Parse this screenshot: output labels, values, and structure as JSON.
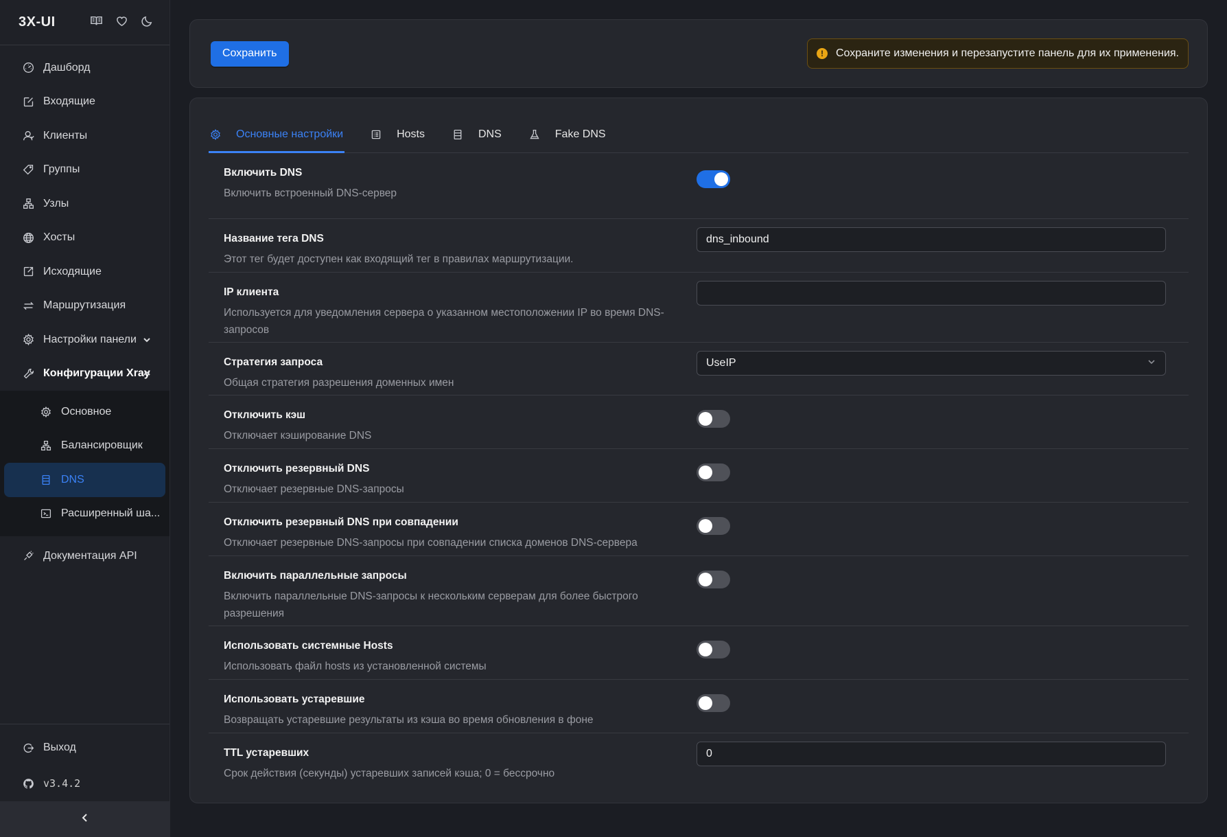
{
  "sidebar": {
    "brand": "3X-UI",
    "brand_icons": [
      "book-icon",
      "heart-icon",
      "moon-icon"
    ],
    "items": [
      {
        "label": "Дашборд",
        "icon": "dashboard-icon"
      },
      {
        "label": "Входящие",
        "icon": "inbound-icon"
      },
      {
        "label": "Клиенты",
        "icon": "clients-icon"
      },
      {
        "label": "Группы",
        "icon": "tag-icon"
      },
      {
        "label": "Узлы",
        "icon": "nodes-icon"
      },
      {
        "label": "Хосты",
        "icon": "globe-icon"
      },
      {
        "label": "Исходящие",
        "icon": "outbound-icon"
      },
      {
        "label": "Маршрутизация",
        "icon": "routing-icon"
      },
      {
        "label": "Настройки панели",
        "icon": "gear-icon"
      },
      {
        "label": "Конфигурации Xray",
        "icon": "wrench-icon"
      }
    ],
    "sub_items": [
      {
        "label": "Основное",
        "icon": "gear-icon"
      },
      {
        "label": "Балансировщик",
        "icon": "nodes-icon"
      },
      {
        "label": "DNS",
        "icon": "server-icon"
      },
      {
        "label": "Расширенный ша...",
        "icon": "terminal-icon"
      }
    ],
    "api_docs": "Документация API",
    "logout": "Выход",
    "version": "v3.4.2"
  },
  "toolbar": {
    "save_label": "Сохранить",
    "alert": "Сохраните изменения и перезапустите панель для их применения."
  },
  "tabs": [
    {
      "label": "Основные настройки",
      "icon": "gear-icon",
      "active": true
    },
    {
      "label": "Hosts",
      "icon": "list-icon",
      "active": false
    },
    {
      "label": "DNS",
      "icon": "server-icon",
      "active": false
    },
    {
      "label": "Fake DNS",
      "icon": "flask-icon",
      "active": false
    }
  ],
  "settings": [
    {
      "title": "Включить DNS",
      "desc": "Включить встроенный DNS-сервер",
      "control": "switch",
      "value": true
    },
    {
      "title": "Название тега DNS",
      "desc": "Этот тег будет доступен как входящий тег в правилах маршрутизации.",
      "control": "input",
      "value": "dns_inbound"
    },
    {
      "title": "IP клиента",
      "desc": "Используется для уведомления сервера о указанном местоположении IP во время DNS-запросов",
      "control": "input",
      "value": ""
    },
    {
      "title": "Стратегия запроса",
      "desc": "Общая стратегия разрешения доменных имен",
      "control": "select",
      "value": "UseIP"
    },
    {
      "title": "Отключить кэш",
      "desc": "Отключает кэширование DNS",
      "control": "switch",
      "value": false
    },
    {
      "title": "Отключить резервный DNS",
      "desc": "Отключает резервные DNS-запросы",
      "control": "switch",
      "value": false
    },
    {
      "title": "Отключить резервный DNS при совпадении",
      "desc": "Отключает резервные DNS-запросы при совпадении списка доменов DNS-сервера",
      "control": "switch",
      "value": false
    },
    {
      "title": "Включить параллельные запросы",
      "desc": "Включить параллельные DNS-запросы к нескольким серверам для более быстрого разрешения",
      "control": "switch",
      "value": false
    },
    {
      "title": "Использовать системные Hosts",
      "desc": "Использовать файл hosts из установленной системы",
      "control": "switch",
      "value": false
    },
    {
      "title": "Использовать устаревшие",
      "desc": "Возвращать устаревшие результаты из кэша во время обновления в фоне",
      "control": "switch",
      "value": false
    },
    {
      "title": "TTL устаревших",
      "desc": "Срок действия (секунды) устаревших записей кэша; 0 = бессрочно",
      "control": "input",
      "value": "0"
    }
  ],
  "colors": {
    "accent": "#1f6fe5",
    "active_text": "#3b82f6",
    "warning": "#e9a514"
  }
}
